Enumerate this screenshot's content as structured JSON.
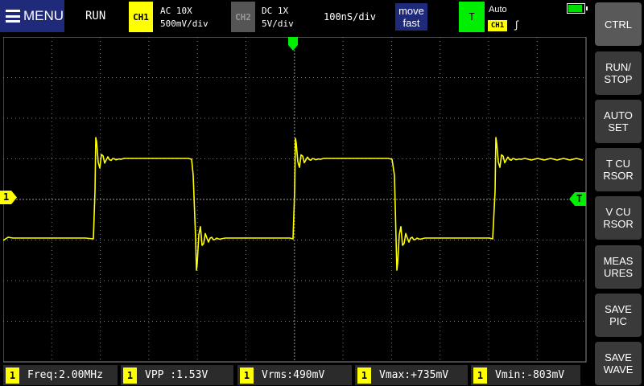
{
  "topbar": {
    "menu_label": "MENU",
    "run_state": "RUN",
    "ch1": {
      "tag": "CH1",
      "coupling": "AC  10X",
      "scale": "500mV/div"
    },
    "ch2": {
      "tag": "CH2",
      "coupling": "DC  1X",
      "scale": "5V/div"
    },
    "timebase": "100nS/div",
    "move_line1": "move",
    "move_line2": "fast",
    "trigger": {
      "tag": "T",
      "mode": "Auto",
      "source": "CH1",
      "edge": "ʃ"
    },
    "battery_level_pct": 90
  },
  "sidebar": {
    "buttons": [
      {
        "id": "ctrl",
        "label": "CTRL"
      },
      {
        "id": "run-stop",
        "label": "RUN/\nSTOP"
      },
      {
        "id": "auto-set",
        "label": "AUTO\nSET"
      },
      {
        "id": "t-cursor",
        "label": "T CU\nRSOR"
      },
      {
        "id": "v-cursor",
        "label": "V CU\nRSOR"
      },
      {
        "id": "measures",
        "label": "MEAS\nURES"
      },
      {
        "id": "save-pic",
        "label": "SAVE\nPIC"
      },
      {
        "id": "save-wave",
        "label": "SAVE\nWAVE"
      }
    ]
  },
  "markers": {
    "ch1_ground": "1",
    "trigger_level": "T"
  },
  "measurements": [
    {
      "ch": "1",
      "text": "Freq:2.00MHz"
    },
    {
      "ch": "1",
      "text": "VPP :1.53V"
    },
    {
      "ch": "1",
      "text": "Vrms:490mV"
    },
    {
      "ch": "1",
      "text": "Vmax:+735mV"
    },
    {
      "ch": "1",
      "text": "Vmin:-803mV"
    }
  ],
  "colors": {
    "ch1": "#ffff00",
    "trigger": "#00ee00",
    "accent": "#1f2a7a",
    "grid": "#808080"
  }
}
